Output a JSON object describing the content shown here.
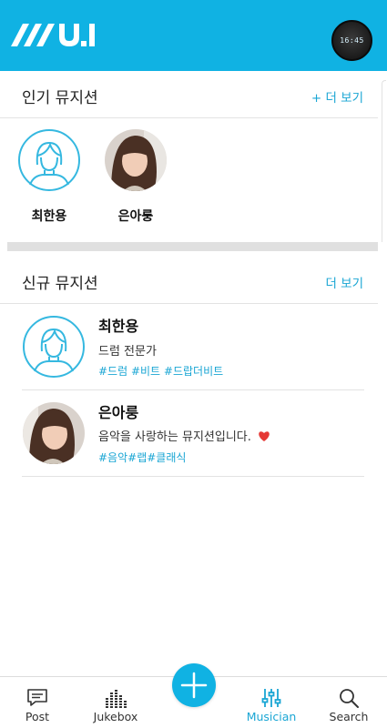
{
  "app": {
    "logo_text": "MU.I",
    "profile_clock": "16:45"
  },
  "popular": {
    "title": "인기 뮤지션",
    "more_label": "+ 더 보기",
    "items": [
      {
        "name": "최한용",
        "avatar": "placeholder"
      },
      {
        "name": "은아룽",
        "avatar": "photo"
      }
    ]
  },
  "new_musicians": {
    "title": "신규 뮤지션",
    "more_label": "더 보기",
    "items": [
      {
        "name": "최한용",
        "desc": "드럼 전문가",
        "tags": "#드럼 #비트 #드랍더비트",
        "avatar": "placeholder"
      },
      {
        "name": "은아룽",
        "desc": "음악을 사랑하는 뮤지션입니다.",
        "tags": "#음악#랩#클래식",
        "avatar": "photo"
      }
    ]
  },
  "nav": {
    "items": [
      {
        "label": "Post",
        "icon": "chat-bubble-icon"
      },
      {
        "label": "Jukebox",
        "icon": "equalizer-icon"
      },
      {
        "label": "",
        "icon": "plus-icon"
      },
      {
        "label": "Musician",
        "icon": "sliders-icon",
        "active": true
      },
      {
        "label": "Search",
        "icon": "search-icon"
      }
    ]
  },
  "colors": {
    "accent": "#10b2e3",
    "link": "#1aa6d4",
    "divider": "#e0e0e0",
    "heart": "#e53935"
  }
}
